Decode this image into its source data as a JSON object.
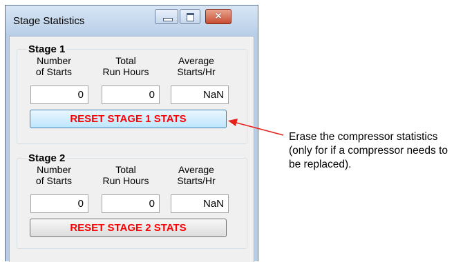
{
  "window": {
    "title": "Stage Statistics",
    "controls": {
      "minimize": "minimize",
      "maximize": "maximize",
      "close": "×"
    }
  },
  "stages": [
    {
      "label": "Stage 1",
      "columns": [
        "Number\nof Starts",
        "Total\nRun Hours",
        "Average\nStarts/Hr"
      ],
      "values": {
        "starts": "0",
        "run_hours": "0",
        "avg_starts": "NaN"
      },
      "reset_label": "RESET STAGE 1 STATS"
    },
    {
      "label": "Stage 2",
      "columns": [
        "Number\nof Starts",
        "Total\nRun Hours",
        "Average\nStarts/Hr"
      ],
      "values": {
        "starts": "0",
        "run_hours": "0",
        "avg_starts": "NaN"
      },
      "reset_label": "RESET STAGE 2 STATS"
    }
  ],
  "annotation": {
    "text": "Erase the compressor statistics (only for if a compressor needs to be replaced).",
    "arrow_color": "#e8201a"
  },
  "colors": {
    "button_text": "#ff0000"
  }
}
